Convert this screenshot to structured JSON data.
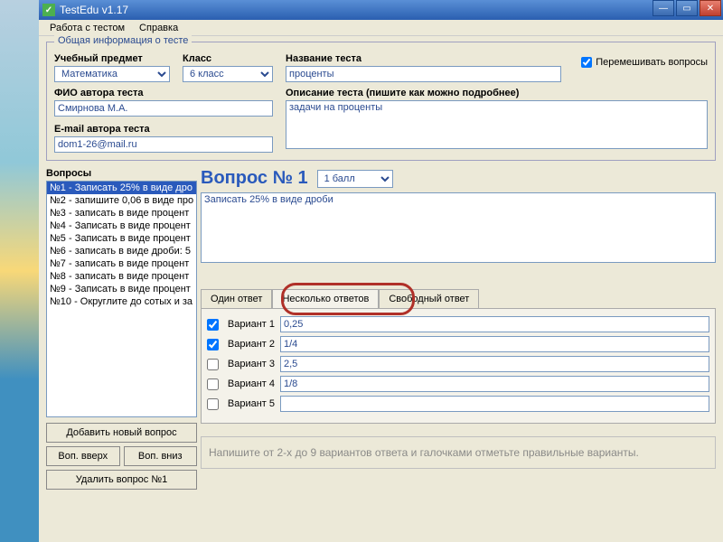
{
  "window": {
    "title": "TestEdu v1.17"
  },
  "menu": {
    "work": "Работа с тестом",
    "help": "Справка"
  },
  "groupbox_title": "Общая информация о тесте",
  "fields": {
    "subject_label": "Учебный предмет",
    "subject_value": "Математика",
    "class_label": "Класс",
    "class_value": "6 класс",
    "testname_label": "Название теста",
    "testname_value": "проценты",
    "shuffle_label": "Перемешивать вопросы",
    "author_label": "ФИО автора теста",
    "author_value": "Смирнова М.А.",
    "desc_label": "Описание теста (пишите как можно подробнее)",
    "desc_value": "задачи на проценты",
    "email_label": "E-mail автора теста",
    "email_value": "dom1-26@mail.ru"
  },
  "sidebar": {
    "label": "Вопросы",
    "items": [
      "№1 - Записать 25% в виде дро",
      "№2 - запишите 0,06 в виде про",
      "№3 - записать в виде процент",
      "№4 - Записать в виде процент",
      "№5 - Записать в виде процент",
      "№6 - записать в виде дроби: 5",
      "№7 - записать в виде процент",
      "№8 - записать в виде процент",
      "№9 - Записать в виде процент",
      "№10 - Округлите до сотых и за"
    ],
    "add": "Добавить новый вопрос",
    "up": "Воп. вверх",
    "down": "Воп. вниз",
    "delete": "Удалить вопрос №1"
  },
  "question": {
    "title": "Вопрос № 1",
    "score": "1 балл",
    "text": "Записать 25% в виде дроби"
  },
  "tabs": {
    "one": "Один ответ",
    "many": "Несколько ответов",
    "free": "Свободный ответ"
  },
  "answers": [
    {
      "label": "Вариант 1",
      "value": "0,25",
      "checked": true
    },
    {
      "label": "Вариант 2",
      "value": "1/4",
      "checked": true
    },
    {
      "label": "Вариант 3",
      "value": "2,5",
      "checked": false
    },
    {
      "label": "Вариант 4",
      "value": "1/8",
      "checked": false
    },
    {
      "label": "Вариант 5",
      "value": "",
      "checked": false
    }
  ],
  "hint": "Напишите от 2-х до 9 вариантов ответа и галочками отметьте правильные варианты."
}
